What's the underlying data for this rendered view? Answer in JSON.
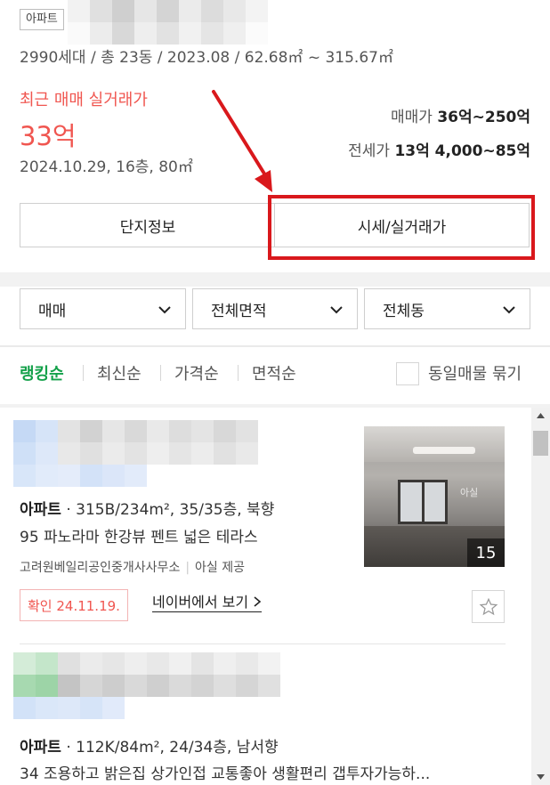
{
  "complex": {
    "type_badge": "아파트",
    "summary": "2990세대 / 총 23동 / 2023.08 / 62.68㎡ ~ 315.67㎡",
    "recent_trade_label": "최근 매매 실거래가",
    "recent_trade_price": "33억",
    "recent_trade_meta": "2024.10.29, 16층, 80㎡",
    "sale_label": "매매가",
    "sale_range": "36억~250억",
    "jeonse_label": "전세가",
    "jeonse_range": "13억 4,000~85억"
  },
  "tabs": {
    "complex_info": "단지정보",
    "market_price": "시세/실거래가"
  },
  "filters": {
    "trade_type": "매매",
    "area": "전체면적",
    "building": "전체동"
  },
  "sort": {
    "ranking": "랭킹순",
    "latest": "최신순",
    "price": "가격순",
    "area": "면적순",
    "group_label": "동일매물 묶기"
  },
  "listings": [
    {
      "type": "아파트",
      "spec": "315B/234m², 35/35층, 북향",
      "description": "95 파노라마 한강뷰 펜트 넓은 테라스",
      "agent": "고려원베일리공인중개사사무소",
      "provider": "아실 제공",
      "confirm": "확인 24.11.19.",
      "naver_link": "네이버에서 보기",
      "photo_watermark": "아실",
      "photo_count": "15"
    },
    {
      "type": "아파트",
      "spec": "112K/84m², 24/34층, 남서향",
      "description": "34 조용하고 밝은집 상가인접 교통좋아 생활편리 갭투자가능하..."
    }
  ],
  "icons": {
    "chevron": "chevron-down-icon",
    "star": "star-outline-icon",
    "scroll_up": "scroll-up-arrow-icon",
    "scroll_down": "scroll-down-arrow-icon"
  },
  "colors": {
    "accent_red": "#f05650",
    "highlight_box": "#d9181c",
    "active_sort_green": "#14a14a"
  }
}
